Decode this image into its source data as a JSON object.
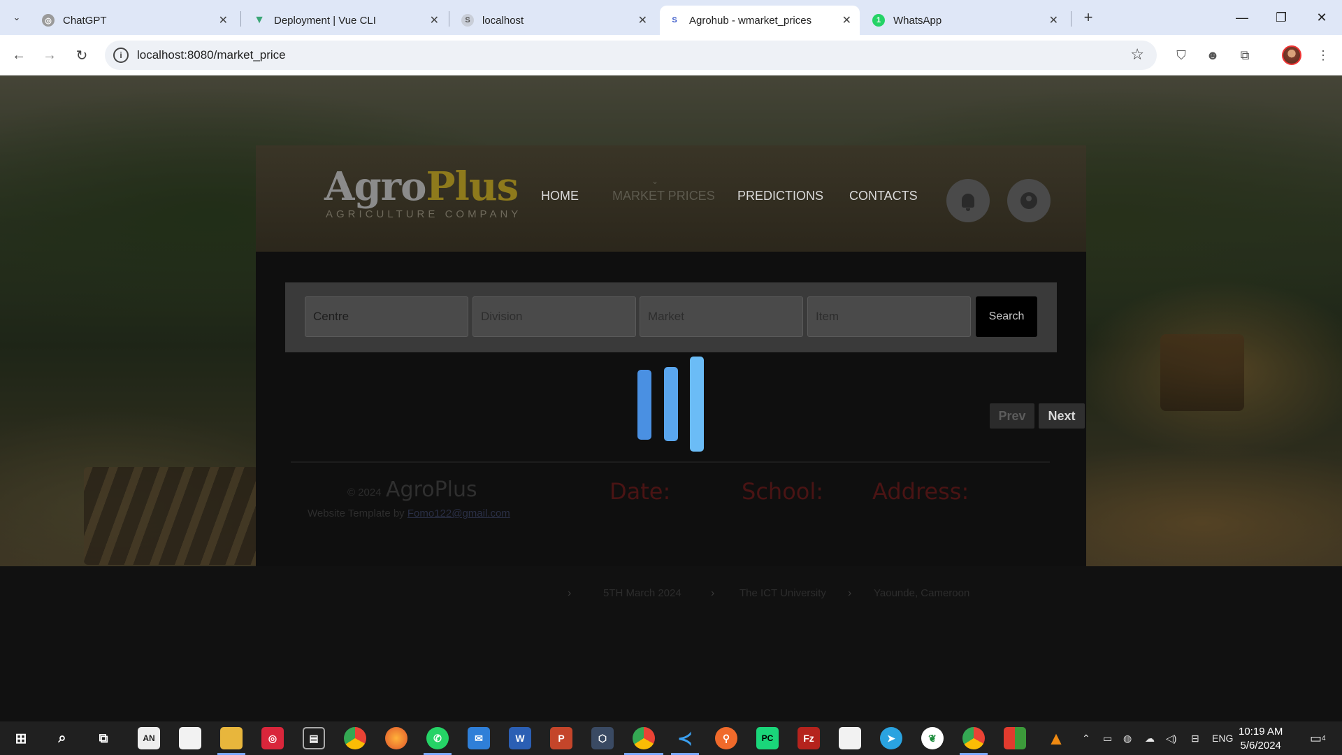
{
  "browser": {
    "tabs": [
      {
        "title": "ChatGPT",
        "icon": "chatgpt-icon"
      },
      {
        "title": "Deployment | Vue CLI",
        "icon": "vue-icon"
      },
      {
        "title": "localhost",
        "icon": "localhost-icon"
      },
      {
        "title": "Agrohub - wmarket_prices",
        "icon": "agrohub-icon",
        "active": true
      },
      {
        "title": "WhatsApp",
        "icon": "whatsapp-icon"
      }
    ],
    "url": "localhost:8080/market_price",
    "new_tab": "+"
  },
  "header": {
    "logo_agro": "Agro",
    "logo_plus": "Plus",
    "logo_sub": "AGRICULTURE COMPANY",
    "nav": [
      "HOME",
      "MARKET PRICES",
      "PREDICTIONS",
      "CONTACTS"
    ]
  },
  "search": {
    "centre_placeholder": "Centre",
    "division_placeholder": "Division",
    "market_placeholder": "Market",
    "item_placeholder": "Item",
    "button": "Search"
  },
  "pagination": {
    "prev": "Prev",
    "next": "Next"
  },
  "loader": {
    "bar_colors": [
      "#4a90e2",
      "#5aa6ee",
      "#6bbcf6"
    ]
  },
  "footer": {
    "copyright": "© 2024",
    "brand": "AgroPlus",
    "credit_prefix": "Website Template by",
    "credit_email": "Fomo122@gmail.com",
    "columns": [
      {
        "heading": "Date:",
        "value": "5TH March 2024"
      },
      {
        "heading": "School:",
        "value": "The ICT University"
      },
      {
        "heading": "Address:",
        "value": "Yaounde, Cameroon"
      }
    ]
  },
  "taskbar": {
    "clock_time": "10:19 AM",
    "clock_date": "5/6/2024",
    "language": "ENG",
    "notifications": "4"
  }
}
